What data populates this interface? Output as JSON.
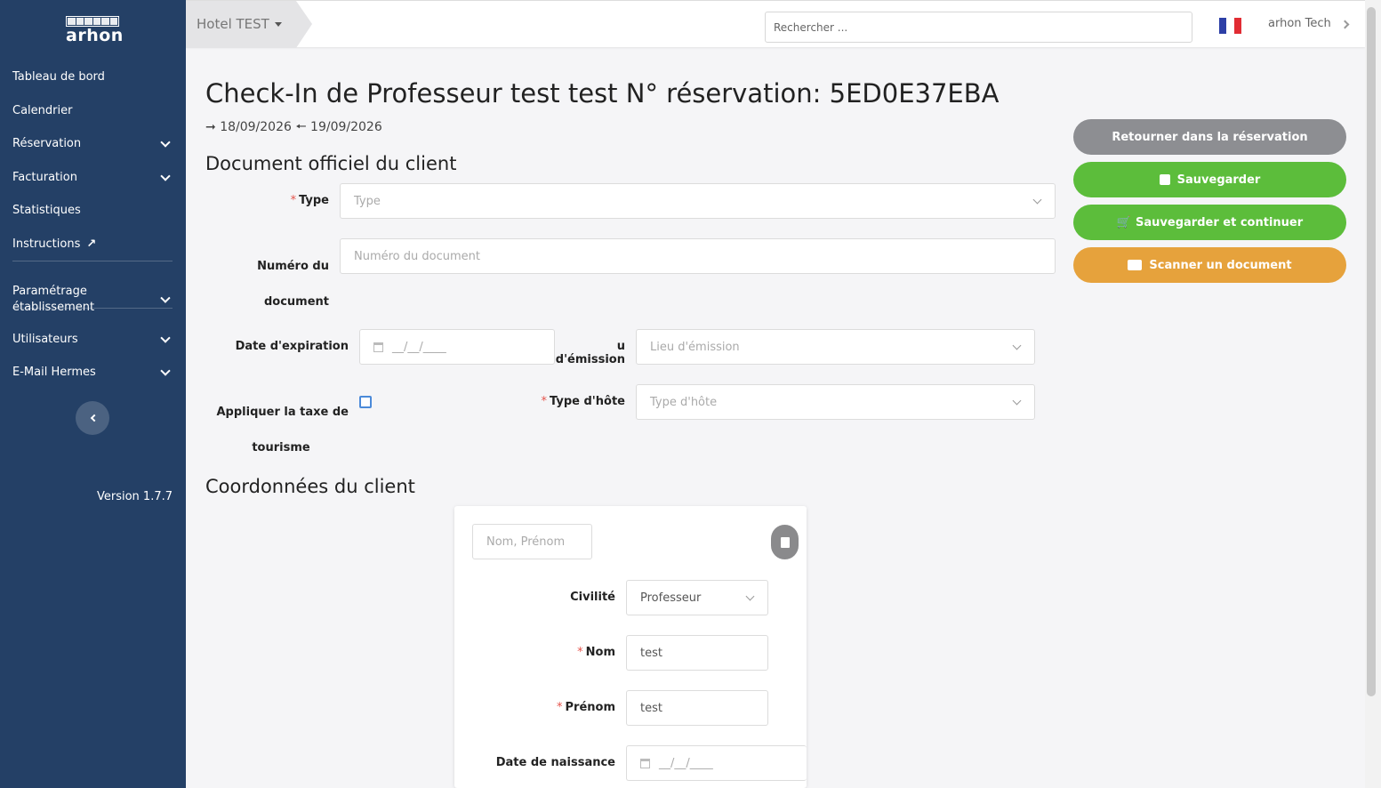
{
  "sidebar": {
    "logo_text": "arhon",
    "items": [
      {
        "label": "Tableau de bord",
        "has_chevron": false
      },
      {
        "label": "Calendrier",
        "has_chevron": false
      },
      {
        "label": "Réservation",
        "has_chevron": true
      },
      {
        "label": "Facturation",
        "has_chevron": true
      },
      {
        "label": "Statistiques",
        "has_chevron": false
      },
      {
        "label": "Instructions",
        "has_chevron": false,
        "icon": "external-link-icon"
      },
      {
        "label": "Paramétrage établissement",
        "has_chevron": true
      },
      {
        "label": "Utilisateurs",
        "has_chevron": true
      },
      {
        "label": "E-Mail Hermes",
        "has_chevron": true
      }
    ],
    "version": "Version 1.7.7"
  },
  "topbar": {
    "hotel": "Hotel TEST",
    "search_placeholder": "Rechercher ...",
    "user": "arhon Tech",
    "flag": "fr-flag-icon"
  },
  "page": {
    "title": "Check-In de Professeur test test N° réservation: 5ED0E37EBA",
    "date_in": "18/09/2026",
    "date_out": "19/09/2026"
  },
  "document_section": {
    "heading": "Document officiel du client",
    "type_label": "Type",
    "type_placeholder": "Type",
    "number_label_1": "Numéro du",
    "number_label_2": "document",
    "number_placeholder": "Numéro du document",
    "expiry_label": "Date d'expiration",
    "expiry_placeholder": "__/__/____",
    "place_label": "u d'émission",
    "place_placeholder": "Lieu d'émission",
    "tax_label_1": "Appliquer la taxe de",
    "tax_label_2": "tourisme",
    "host_type_label": "Type d'hôte",
    "host_type_placeholder": "Type d'hôte"
  },
  "actions": {
    "back": "Retourner dans la réservation",
    "save": "Sauvegarder",
    "save_continue": "Sauvegarder et continuer",
    "scan": "Scanner un document",
    "colors": {
      "back": "#8d8e92",
      "save": "#5cbd3b",
      "scan": "#e6a23c"
    }
  },
  "client_section": {
    "heading": "Coordonnées du client",
    "name_placeholder": "Nom, Prénom",
    "civility_label": "Civilité",
    "civility_value": "Professeur",
    "lastname_label": "Nom",
    "lastname_value": "test",
    "firstname_label": "Prénom",
    "firstname_value": "test",
    "birthdate_label": "Date de naissance",
    "birthdate_placeholder": "__/__/____"
  }
}
